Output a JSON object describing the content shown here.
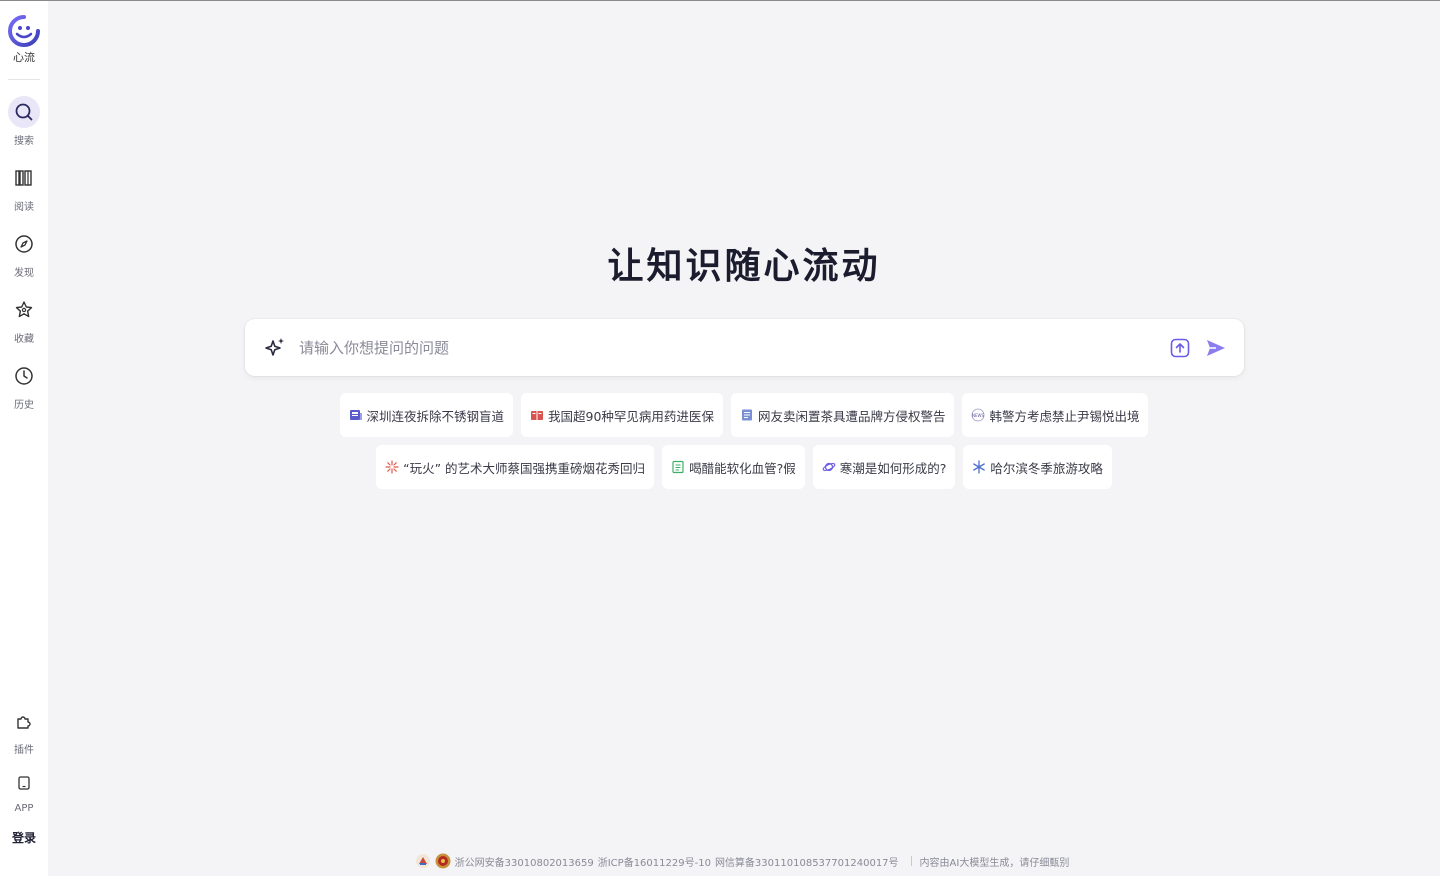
{
  "app": {
    "name": "心流"
  },
  "sidebar": {
    "items": [
      {
        "label": "搜索",
        "icon": "search-icon",
        "active": true
      },
      {
        "label": "阅读",
        "icon": "books-icon",
        "active": false
      },
      {
        "label": "发现",
        "icon": "compass-icon",
        "active": false
      },
      {
        "label": "收藏",
        "icon": "star-icon",
        "active": false
      },
      {
        "label": "历史",
        "icon": "clock-icon",
        "active": false
      }
    ],
    "bottom": [
      {
        "label": "插件",
        "icon": "puzzle-icon"
      },
      {
        "label": "APP",
        "icon": "tablet-icon"
      }
    ],
    "login_label": "登录"
  },
  "hero": {
    "title": "让知识随心流动"
  },
  "search": {
    "placeholder": "请输入你想提问的问题"
  },
  "suggestions": {
    "row1": [
      "深圳连夜拆除不锈钢盲道",
      "我国超90种罕见病用药进医保",
      "网友卖闲置茶具遭品牌方侵权警告",
      "韩警方考虑禁止尹锡悦出境"
    ],
    "row2": [
      "“玩火” 的艺术大师蔡国强携重磅烟花秀回归",
      "喝醋能软化血管?假",
      "寒潮是如何形成的?",
      "哈尔滨冬季旅游攻略"
    ]
  },
  "footer": {
    "police": "浙公网安备33010802013659",
    "icp": "浙ICP备16011229号-10",
    "algo": "网信算备330110108537701240017号",
    "disclaimer": "内容由AI大模型生成，请仔细甄别"
  },
  "colors": {
    "accent": "#6b5ce7",
    "send": "#8b7cf0"
  }
}
